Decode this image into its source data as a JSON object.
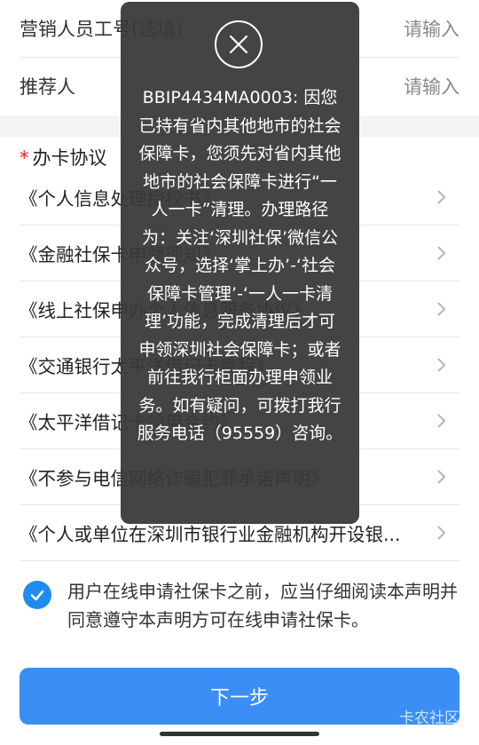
{
  "form": {
    "staff_id": {
      "label": "营销人员工号(选填)",
      "placeholder": "请输入"
    },
    "referrer": {
      "label": "推荐人",
      "placeholder": "请输入"
    }
  },
  "agreements": {
    "required_mark": "*",
    "title": "办卡协议",
    "items": [
      {
        "label": "《个人信息处理授权书》"
      },
      {
        "label": "《金融社保卡申领须知》"
      },
      {
        "label": "《线上社保申办个人信息服务协议》"
      },
      {
        "label": "《交通银行太平洋借记卡章程》"
      },
      {
        "label": "《太平洋借记卡领用合约》"
      },
      {
        "label": "《不参与电信网络诈骗犯罪承诺声明》"
      },
      {
        "label": "《个人或单位在深圳市银行业金融机构开设银..."
      }
    ]
  },
  "consent": {
    "checked": true,
    "text": "用户在线申请社保卡之前，应当仔细阅读本声明并同意遵守本声明方可在线申请社保卡。"
  },
  "next_button": {
    "label": "下一步"
  },
  "watermark": "卡农社区",
  "toast": {
    "icon": "close-icon",
    "message": "BBIP4434MA0003: 因您已持有省内其他地市的社会保障卡，您须先对省内其他地市的社会保障卡进行“一人一卡”清理。办理路径为：关注‘深圳社保’微信公众号，选择‘掌上办’-‘社会保障卡管理’-‘一人一卡清理’功能，完成清理后才可申领深圳社会保障卡；或者前往我行柜面办理申领业务。如有疑问，可拨打我行服务电话（95559）咨询。"
  },
  "colors": {
    "primary": "#3a8ef6",
    "check": "#1e8cf0",
    "required": "#e02020",
    "toast_bg": "#3a3a3a"
  }
}
